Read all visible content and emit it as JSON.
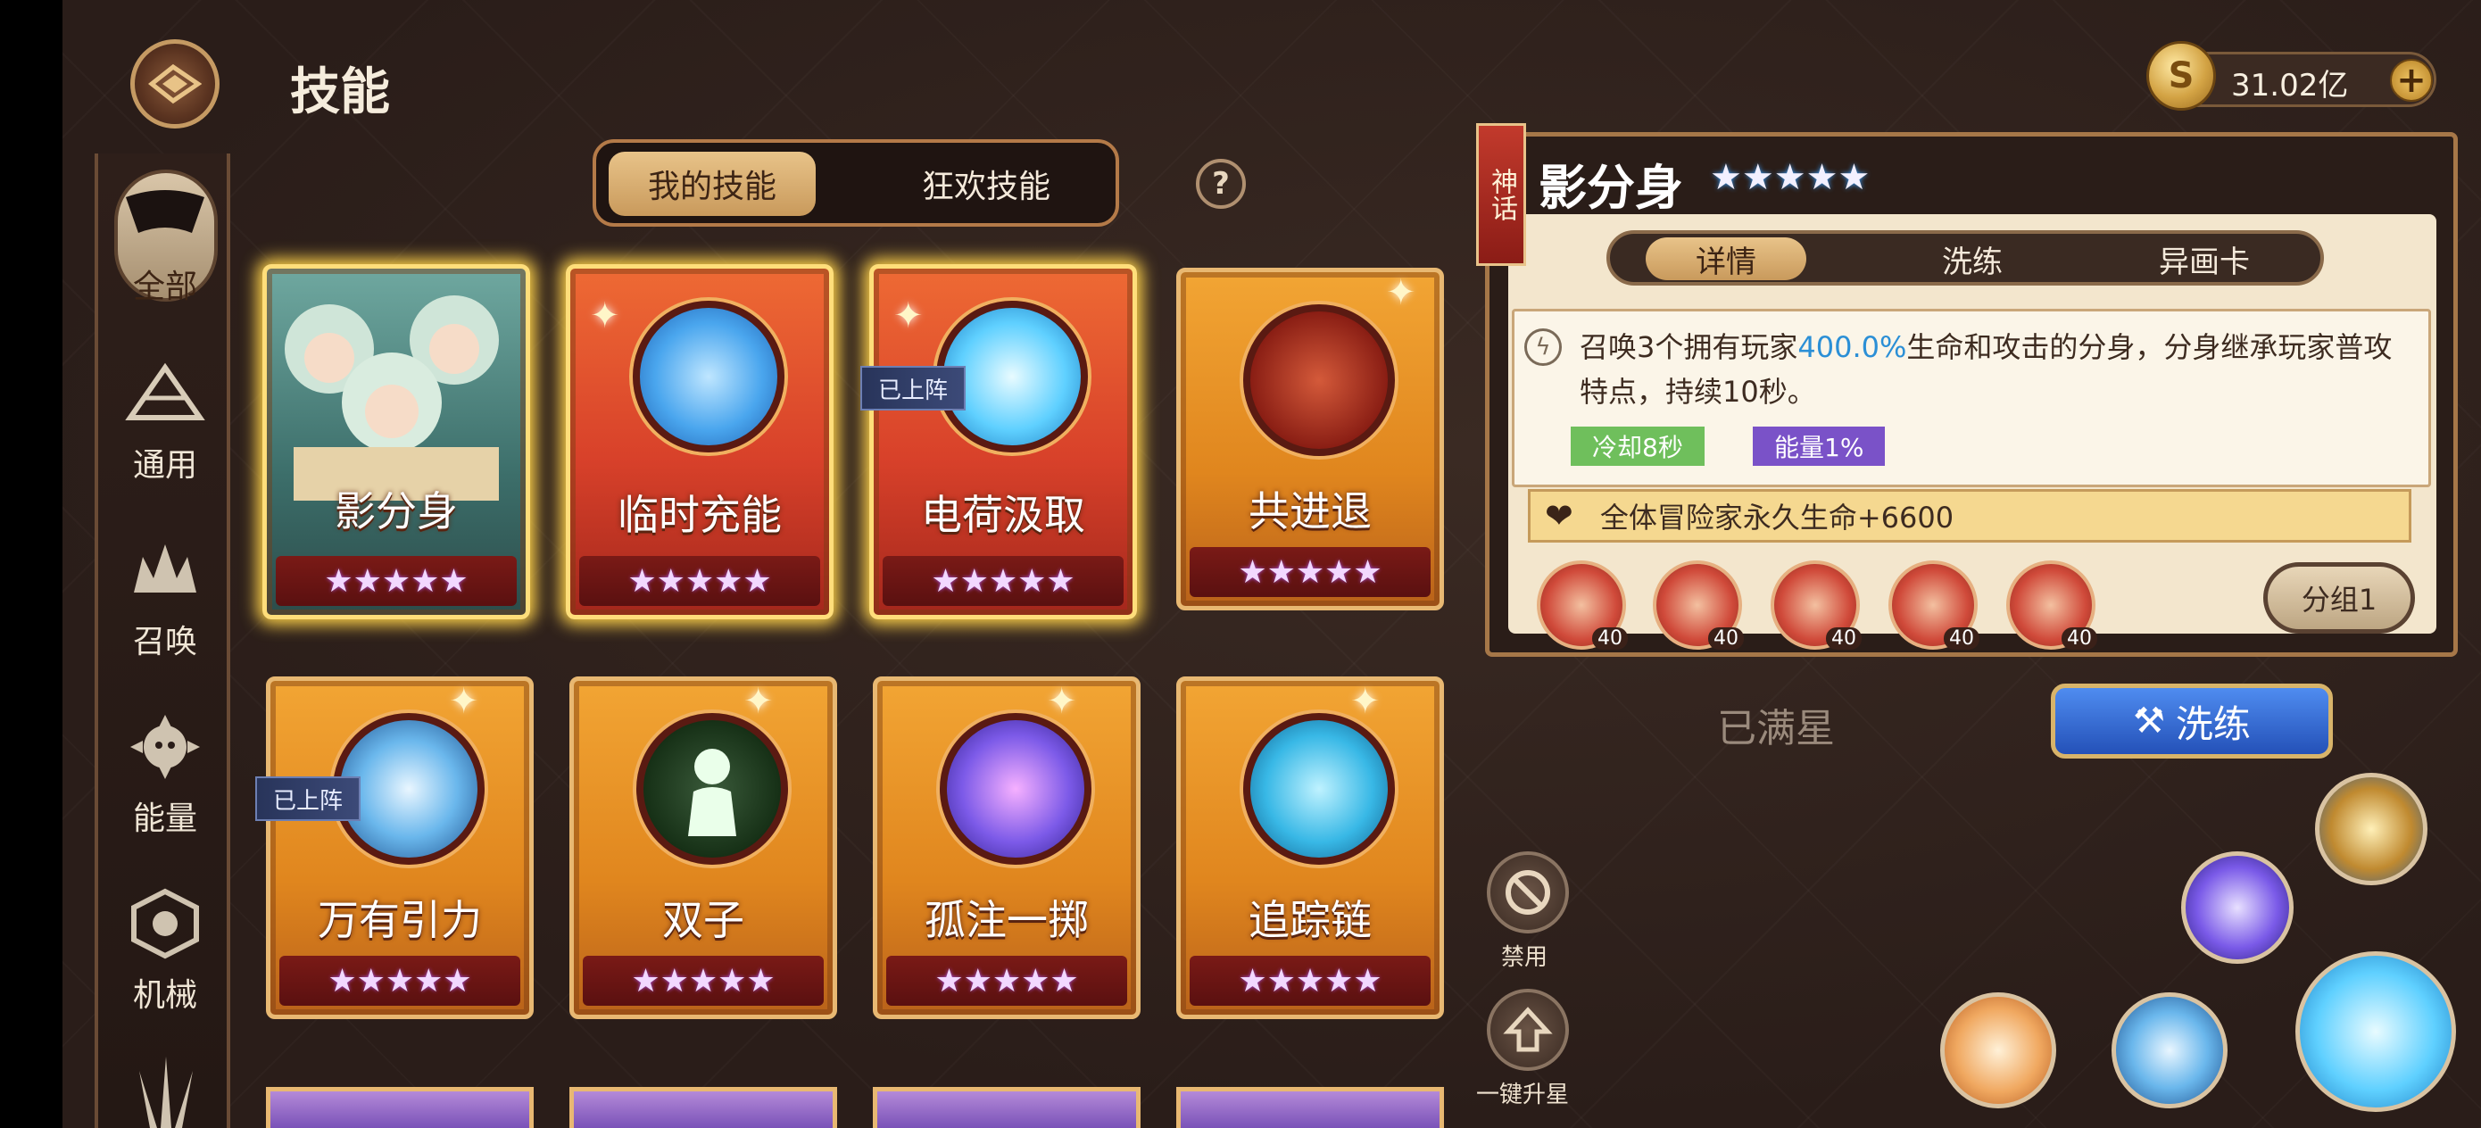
{
  "header": {
    "title": "技能",
    "currency": "31.02亿",
    "plus": "+",
    "coin_symbol": "S"
  },
  "sidebar": {
    "items": [
      {
        "label": "全部",
        "icon": "all-icon",
        "active": true
      },
      {
        "label": "通用",
        "icon": "common-icon"
      },
      {
        "label": "召唤",
        "icon": "summon-icon"
      },
      {
        "label": "能量",
        "icon": "energy-icon"
      },
      {
        "label": "机械",
        "icon": "mech-icon"
      }
    ]
  },
  "tabs": {
    "my_skills": "我的技能",
    "carnival_skills": "狂欢技能",
    "help": "?"
  },
  "cards": [
    {
      "name": "影分身",
      "stars": "★★★★★",
      "style": "portrait",
      "selected": true
    },
    {
      "name": "临时充能",
      "stars": "★★★★★",
      "style": "red",
      "selected": true
    },
    {
      "name": "电荷汲取",
      "stars": "★★★★★",
      "style": "red",
      "selected": true,
      "badge": "已上阵"
    },
    {
      "name": "共进退",
      "stars": "★★★★★",
      "style": "orange"
    },
    {
      "name": "万有引力",
      "stars": "★★★★★",
      "style": "orange",
      "badge": "已上阵"
    },
    {
      "name": "双子",
      "stars": "★★★★★",
      "style": "orange"
    },
    {
      "name": "孤注一掷",
      "stars": "★★★★★",
      "style": "orange"
    },
    {
      "name": "追踪链",
      "stars": "★★★★★",
      "style": "orange"
    }
  ],
  "detail": {
    "rarity": "神话",
    "name": "影分身",
    "stars": "★★★★★",
    "tabs": [
      "详情",
      "洗练",
      "异画卡"
    ],
    "desc_1": "召唤3个拥有玩家",
    "desc_hl": "400.0%",
    "desc_2": "生命和攻击的分身，分身继承玩家普攻特点，持续10秒。",
    "cooldown": "冷却8秒",
    "energy": "能量1%",
    "bond": "全体冒险家永久生命+6600",
    "rune_levels": [
      "40",
      "40",
      "40",
      "40",
      "40"
    ],
    "group": "分组1"
  },
  "status": {
    "full_star": "已满星",
    "refine": "洗练"
  },
  "actions": {
    "disable": "禁用",
    "upgrade_all": "一键升星"
  },
  "colors": {
    "accent": "#e8b872",
    "cooldown": "#6fbf5c",
    "energy": "#7a52c8",
    "highlight": "#2b8fd6"
  }
}
